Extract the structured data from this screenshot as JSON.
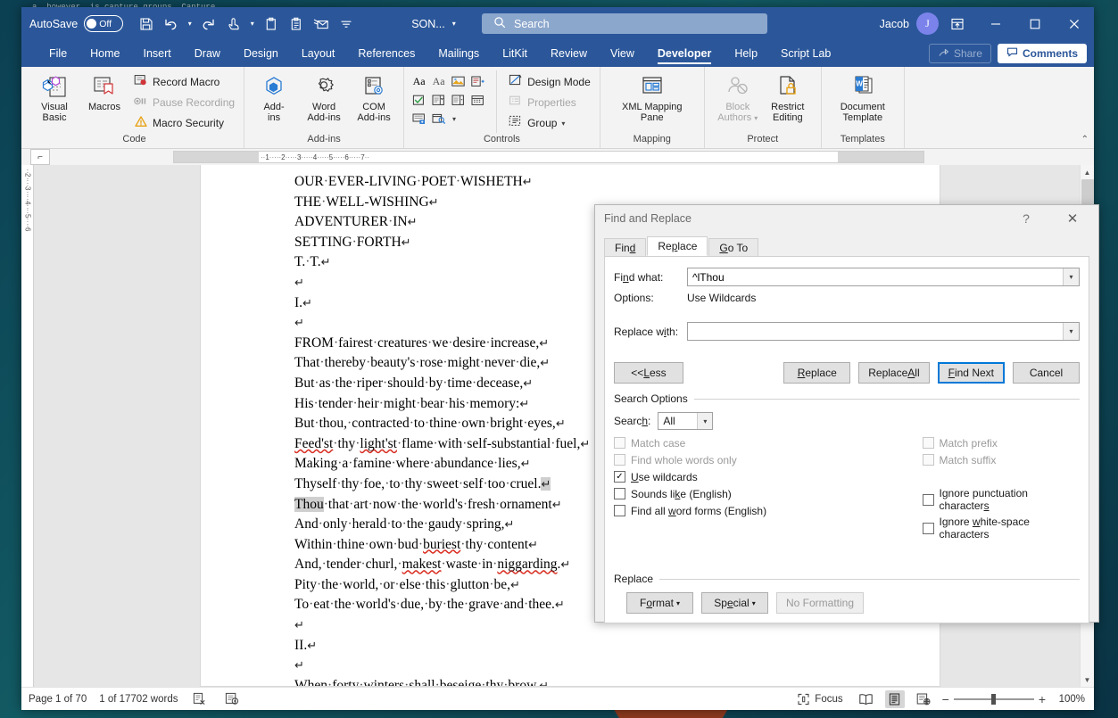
{
  "backdrop": {
    "code_snippet": "a, however, is capture groups. Capture"
  },
  "titlebar": {
    "autosave_label": "AutoSave",
    "autosave_state": "Off",
    "quick_access": [
      {
        "name": "save-icon",
        "glyph": "save"
      },
      {
        "name": "undo-icon",
        "glyph": "undo"
      },
      {
        "name": "redo-icon",
        "glyph": "redo"
      },
      {
        "name": "touch-mode-icon",
        "glyph": "touch"
      },
      {
        "name": "paste-icon",
        "glyph": "clipboard"
      },
      {
        "name": "copy-icon",
        "glyph": "clipboard2"
      },
      {
        "name": "email-icon",
        "glyph": "email"
      },
      {
        "name": "customize-quick-access-icon",
        "glyph": "more"
      }
    ],
    "document_title": "SON...",
    "search_placeholder": "Search",
    "user_name": "Jacob",
    "avatar_initial": "J",
    "ribbon_display_icon": "ribbon-display-options-icon",
    "minimize": "minimize",
    "maximize": "maximize",
    "close": "close"
  },
  "tabs": [
    {
      "label": "File",
      "active": false
    },
    {
      "label": "Home",
      "active": false
    },
    {
      "label": "Insert",
      "active": false
    },
    {
      "label": "Draw",
      "active": false
    },
    {
      "label": "Design",
      "active": false
    },
    {
      "label": "Layout",
      "active": false
    },
    {
      "label": "References",
      "active": false
    },
    {
      "label": "Mailings",
      "active": false
    },
    {
      "label": "LitKit",
      "active": false
    },
    {
      "label": "Review",
      "active": false
    },
    {
      "label": "View",
      "active": false
    },
    {
      "label": "Developer",
      "active": true
    },
    {
      "label": "Help",
      "active": false
    },
    {
      "label": "Script Lab",
      "active": false
    }
  ],
  "tab_actions": {
    "share_label": "Share",
    "comments_label": "Comments"
  },
  "ribbon": {
    "groups": [
      {
        "name": "code",
        "label": "Code",
        "big_buttons": [
          {
            "label": "Visual\nBasic",
            "label_line1": "Visual",
            "label_line2": "Basic",
            "icon": "visual-basic-icon",
            "disabled": false
          },
          {
            "label": "Macros",
            "label_line1": "Macros",
            "label_line2": "",
            "icon": "macros-icon",
            "disabled": false
          }
        ],
        "small_buttons": [
          {
            "label": "Record Macro",
            "icon": "record-macro-icon",
            "disabled": false
          },
          {
            "label": "Pause Recording",
            "icon": "pause-recording-icon",
            "disabled": true
          },
          {
            "label": "Macro Security",
            "icon": "macro-security-icon",
            "disabled": false
          }
        ]
      },
      {
        "name": "add-ins",
        "label": "Add-ins",
        "big_buttons": [
          {
            "label_line1": "Add-",
            "label_line2": "ins",
            "icon": "add-ins-icon",
            "disabled": false
          },
          {
            "label_line1": "Word",
            "label_line2": "Add-ins",
            "icon": "word-add-ins-icon",
            "disabled": false
          },
          {
            "label_line1": "COM",
            "label_line2": "Add-ins",
            "icon": "com-add-ins-icon",
            "disabled": false
          }
        ],
        "small_buttons": []
      },
      {
        "name": "controls",
        "label": "Controls",
        "big_buttons": [],
        "small_buttons": [
          {
            "label": "Design Mode",
            "icon": "design-mode-icon",
            "disabled": false
          },
          {
            "label": "Properties",
            "icon": "properties-icon",
            "disabled": true
          },
          {
            "label": "Group",
            "icon": "group-icon",
            "disabled": false
          }
        ],
        "control_icons": [
          "rich-text-content-control-icon",
          "plain-text-content-control-icon",
          "picture-content-control-icon",
          "building-block-gallery-icon",
          "check-box-content-control-icon",
          "combo-box-content-control-icon",
          "drop-down-list-content-control-icon",
          "date-picker-content-control-icon",
          "repeating-section-content-control-icon",
          "legacy-tools-icon"
        ]
      },
      {
        "name": "mapping",
        "label": "Mapping",
        "big_buttons": [
          {
            "label_line1": "XML Mapping",
            "label_line2": "Pane",
            "icon": "xml-mapping-pane-icon",
            "disabled": false
          }
        ],
        "small_buttons": []
      },
      {
        "name": "protect",
        "label": "Protect",
        "big_buttons": [
          {
            "label_line1": "Block",
            "label_line2": "Authors",
            "icon": "block-authors-icon",
            "disabled": true
          },
          {
            "label_line1": "Restrict",
            "label_line2": "Editing",
            "icon": "restrict-editing-icon",
            "disabled": false
          }
        ],
        "small_buttons": []
      },
      {
        "name": "templates",
        "label": "Templates",
        "big_buttons": [
          {
            "label_line1": "Document",
            "label_line2": "Template",
            "icon": "document-template-icon",
            "disabled": false
          }
        ],
        "small_buttons": []
      }
    ],
    "collapse_icon": "collapse-ribbon-icon"
  },
  "ruler": {
    "corner_icon": "tab-stop-selector-icon",
    "marks": [
      "1",
      "2",
      "3",
      "4",
      "5",
      "6",
      "7"
    ],
    "vertical_marks": [
      "2",
      "3",
      "4",
      "5",
      "6"
    ]
  },
  "document": {
    "lines": [
      {
        "text": "OUR·EVER-LIVING·POET·WISHETH",
        "pmark": true,
        "clipped": true
      },
      {
        "text": "THE·WELL-WISHING",
        "pmark": true
      },
      {
        "text": "ADVENTURER·IN",
        "pmark": true
      },
      {
        "text": "SETTING·FORTH",
        "pmark": true
      },
      {
        "text": "T.·T.",
        "pmark": true
      },
      {
        "text": "",
        "pmark": true
      },
      {
        "text": "I.",
        "pmark": true
      },
      {
        "text": "",
        "pmark": true
      },
      {
        "text": "FROM·fairest·creatures·we·desire·increase,",
        "pmark": true
      },
      {
        "text": "That·thereby·beauty's·rose·might·never·die,",
        "pmark": true
      },
      {
        "text": "But·as·the·riper·should·by·time·decease,",
        "pmark": true
      },
      {
        "text": "His·tender·heir·might·bear·his·memory:",
        "pmark": true
      },
      {
        "text": "But·thou,·contracted·to·thine·own·bright·eyes,",
        "pmark": true
      },
      {
        "text": "Feed'st·thy·light'st·flame·with·self-substantial·fuel,",
        "pmark": true,
        "misspelled": [
          "Feed'st",
          "light'st"
        ]
      },
      {
        "text": "Making·a·famine·where·abundance·lies,",
        "pmark": true
      },
      {
        "text": "Thyself·thy·foe,·to·thy·sweet·self·too·cruel.",
        "pmark": true,
        "pmark_selected": true
      },
      {
        "text": "Thou·that·art·now·the·world's·fresh·ornament",
        "pmark": true,
        "selected_word": "Thou"
      },
      {
        "text": "And·only·herald·to·the·gaudy·spring,",
        "pmark": true
      },
      {
        "text": "Within·thine·own·bud·buriest·thy·content",
        "pmark": true,
        "misspelled": [
          "buriest"
        ]
      },
      {
        "text": "And,·tender·churl,·makest·waste·in·niggarding.",
        "pmark": true,
        "misspelled": [
          "makest",
          "niggarding"
        ]
      },
      {
        "text": "Pity·the·world,·or·else·this·glutton·be,",
        "pmark": true
      },
      {
        "text": "To·eat·the·world's·due,·by·the·grave·and·thee.",
        "pmark": true
      },
      {
        "text": "",
        "pmark": true
      },
      {
        "text": "II.",
        "pmark": true
      },
      {
        "text": "",
        "pmark": true
      },
      {
        "text": "When·forty·winters·shall·beseige·thy·brow,",
        "pmark": true,
        "misspelled": [
          "beseige"
        ]
      }
    ]
  },
  "find_replace": {
    "title": "Find and Replace",
    "help_glyph": "?",
    "close_glyph": "✕",
    "tabs": [
      {
        "label": "Find",
        "active": false
      },
      {
        "label": "Replace",
        "active": true
      },
      {
        "label": "Go To",
        "active": false
      }
    ],
    "find_what_label": "Find what:",
    "find_what_value": "^lThou",
    "options_label": "Options:",
    "options_value": "Use Wildcards",
    "replace_with_label": "Replace with:",
    "replace_with_value": "",
    "buttons": {
      "less": "<< Less",
      "replace": "Replace",
      "replace_all": "Replace All",
      "find_next": "Find Next",
      "cancel": "Cancel"
    },
    "search_options_label": "Search Options",
    "search_label": "Search:",
    "search_value": "All",
    "checkboxes_left": [
      {
        "label": "Match case",
        "checked": false,
        "disabled": true
      },
      {
        "label": "Find whole words only",
        "checked": false,
        "disabled": true
      },
      {
        "label": "Use wildcards",
        "checked": true,
        "disabled": false
      },
      {
        "label": "Sounds like (English)",
        "checked": false,
        "disabled": false
      },
      {
        "label": "Find all word forms (English)",
        "checked": false,
        "disabled": false
      }
    ],
    "checkboxes_right": [
      {
        "label": "Match prefix",
        "checked": false,
        "disabled": true
      },
      {
        "label": "Match suffix",
        "checked": false,
        "disabled": true
      },
      {
        "label": "",
        "spacer": true
      },
      {
        "label": "Ignore punctuation characters",
        "checked": false,
        "disabled": false
      },
      {
        "label": "Ignore white-space characters",
        "checked": false,
        "disabled": false
      }
    ],
    "replace_section_label": "Replace",
    "format_button": "Format",
    "special_button": "Special",
    "no_formatting_button": "No Formatting"
  },
  "statusbar": {
    "page_info": "Page 1 of 70",
    "word_count": "1 of 17702 words",
    "proofing_icon": "proofing-errors-icon",
    "accessibility_icon": "accessibility-checker-icon",
    "focus_label": "Focus",
    "read_mode_icon": "read-mode-icon",
    "print_layout_icon": "print-layout-icon",
    "web_layout_icon": "web-layout-icon",
    "zoom_out": "−",
    "zoom_in": "+",
    "zoom_level": "100%"
  },
  "colors": {
    "word_blue": "#2b579a",
    "accent_blue": "#0078d7",
    "selection_gray": "#cfcfcf",
    "spell_red": "#d93025"
  }
}
